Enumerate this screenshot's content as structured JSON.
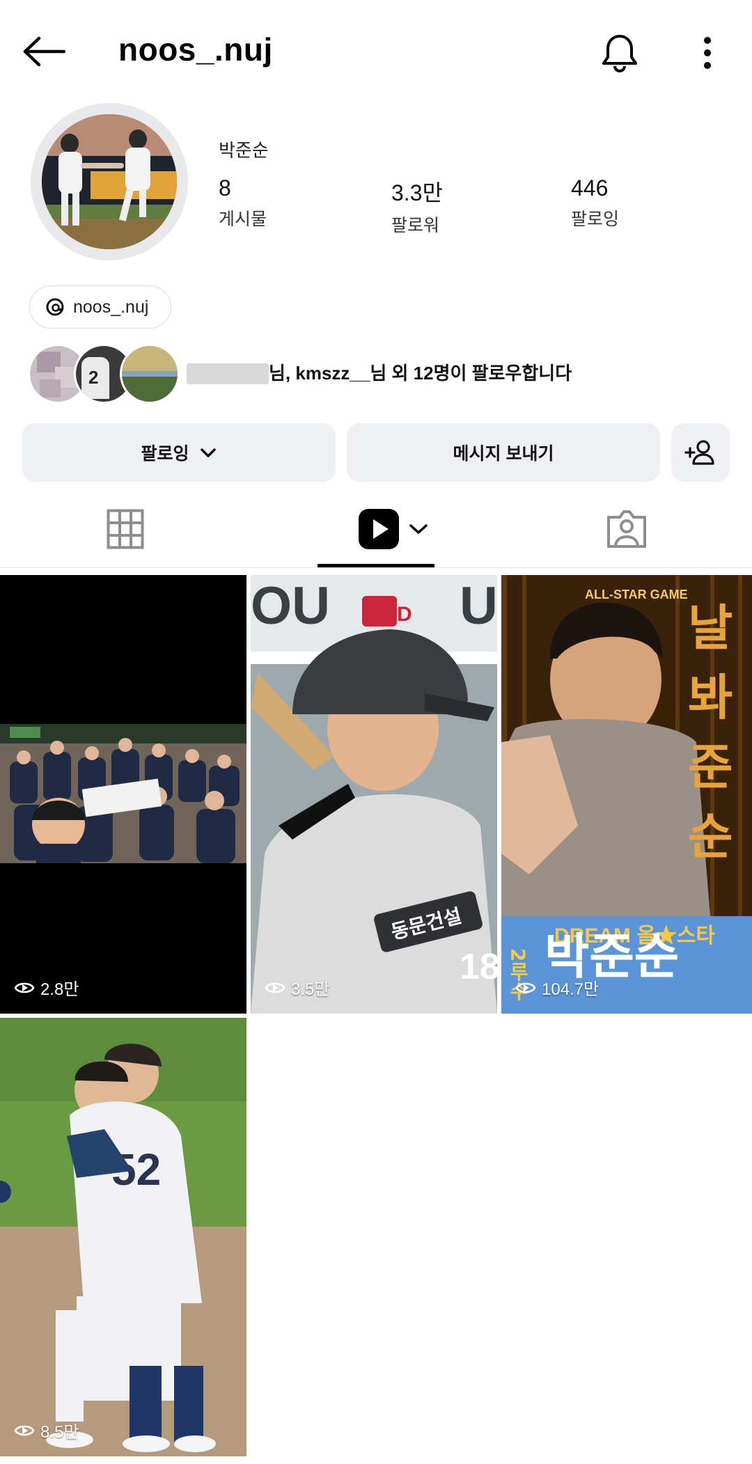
{
  "header": {
    "username": "noos_.nuj"
  },
  "profile": {
    "full_name": "박준순",
    "stats": [
      {
        "value": "8",
        "label": "게시물"
      },
      {
        "value": "3.3만",
        "label": "팔로워"
      },
      {
        "value": "446",
        "label": "팔로잉"
      }
    ],
    "threads_handle": "noos_.nuj",
    "mutual_followers_text": "님, kmszz__님 외 12명이 팔로우합니다"
  },
  "actions": {
    "following_label": "팔로잉",
    "message_label": "메시지 보내기"
  },
  "tabs": {
    "active": "reels"
  },
  "reels": [
    {
      "views": "2.8만"
    },
    {
      "views": "3.5만"
    },
    {
      "views": "104.7만"
    },
    {
      "views": "8.5만"
    }
  ],
  "thumb_texts": {
    "allstar_title": "ALL-STAR GAME",
    "allstar_vertical": "날봐준순",
    "allstar_dream": "DREAM 올★스타",
    "allstar_pos": "2루수",
    "allstar_name": "박준순",
    "dugout_num": "18",
    "sponsor": "동문건설"
  },
  "colors": {
    "accent_blue": "#4a8fd6",
    "gold": "#e8a33a"
  }
}
